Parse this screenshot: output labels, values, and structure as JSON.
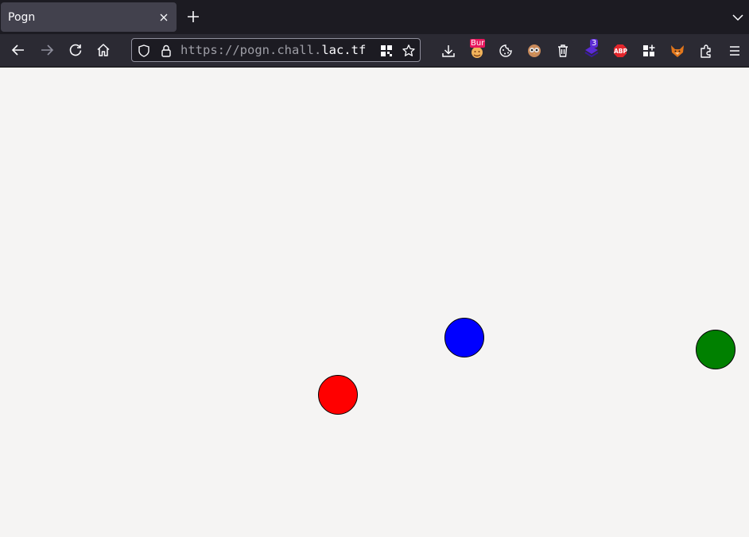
{
  "browser": {
    "tab": {
      "title": "Pogn"
    },
    "url": {
      "scheme_part": "https://pogn.chall.",
      "host_part": "lac.tf"
    },
    "extensions": {
      "burp_badge": "Bur",
      "notification_badge": "3",
      "adblock_label": "ABP"
    }
  },
  "game": {
    "balls": [
      {
        "name": "red-ball",
        "color": "#ff0000"
      },
      {
        "name": "blue-ball",
        "color": "#0000ff"
      },
      {
        "name": "green-ball",
        "color": "#008000"
      }
    ]
  }
}
